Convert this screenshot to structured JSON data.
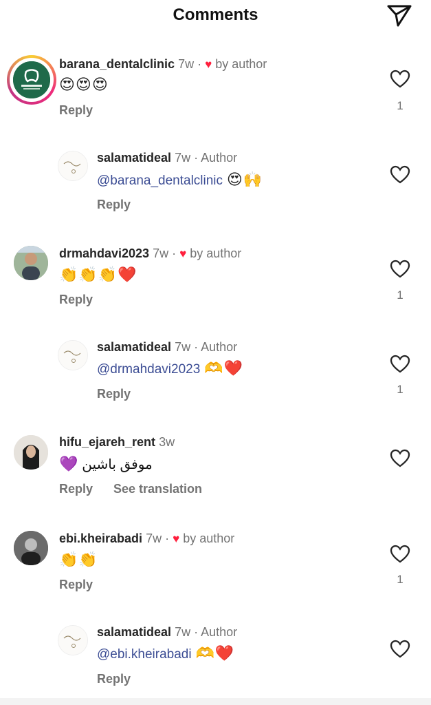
{
  "header": {
    "title": "Comments"
  },
  "comments": [
    {
      "username": "barana_dentalclinic",
      "time": "7w",
      "dot": "·",
      "liked_by_author": "by author",
      "emoji": "😍😍😍",
      "reply_label": "Reply",
      "like_count": "1"
    },
    {
      "username": "salamatideal",
      "time": "7w",
      "dot": "·",
      "author_label": "Author",
      "mention": "@barana_dentalclinic",
      "emoji": "😍🙌",
      "reply_label": "Reply"
    },
    {
      "username": "drmahdavi2023",
      "time": "7w",
      "dot": "·",
      "liked_by_author": "by author",
      "emoji": "👏👏👏❤️",
      "reply_label": "Reply",
      "like_count": "1"
    },
    {
      "username": "salamatideal",
      "time": "7w",
      "dot": "·",
      "author_label": "Author",
      "mention": "@drmahdavi2023",
      "emoji": "🫶❤️",
      "reply_label": "Reply",
      "like_count": "1"
    },
    {
      "username": "hifu_ejareh_rent",
      "time": "3w",
      "text": "موفق باشین",
      "emoji": "💜",
      "reply_label": "Reply",
      "translate_label": "See translation"
    },
    {
      "username": "ebi.kheirabadi",
      "time": "7w",
      "dot": "·",
      "liked_by_author": "by author",
      "emoji": "👏👏",
      "reply_label": "Reply",
      "like_count": "1"
    },
    {
      "username": "salamatideal",
      "time": "7w",
      "dot": "·",
      "author_label": "Author",
      "mention": "@ebi.kheirabadi",
      "emoji": "🫶❤️",
      "reply_label": "Reply"
    }
  ],
  "icons": {
    "send": "paper-plane-icon",
    "like": "heart-outline-icon",
    "author_heart": "heart-filled-icon"
  },
  "colors": {
    "author_heart": "#ff1f3d",
    "mention": "#3c4d94",
    "secondary_text": "#737373"
  }
}
